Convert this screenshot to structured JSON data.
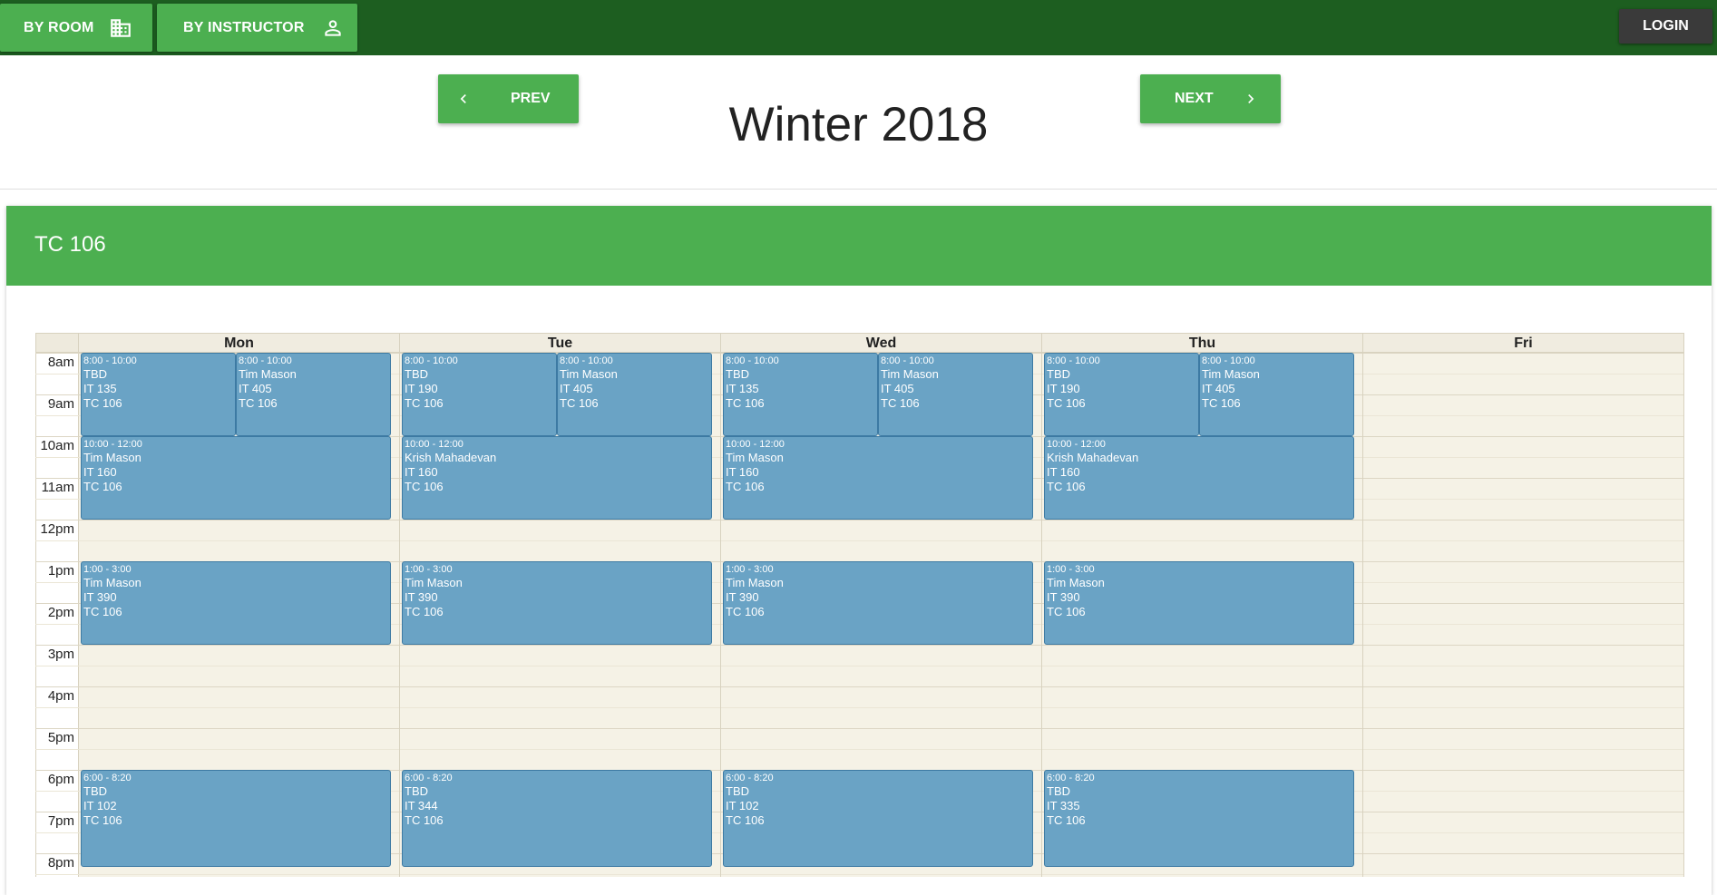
{
  "topbar": {
    "by_room_label": "BY ROOM",
    "by_room_icon": "building-icon",
    "by_instructor_label": "BY INSTRUCTOR",
    "by_instructor_icon": "person-icon",
    "login_label": "LOGIN"
  },
  "term": {
    "prev_label": "PREV",
    "next_label": "NEXT",
    "title": "Winter 2018"
  },
  "room": {
    "title": "TC 106"
  },
  "calendar": {
    "days": [
      "Mon",
      "Tue",
      "Wed",
      "Thu",
      "Fri"
    ],
    "hours": [
      "8am",
      "9am",
      "10am",
      "11am",
      "12pm",
      "1pm",
      "2pm",
      "3pm",
      "4pm",
      "5pm",
      "6pm",
      "7pm",
      "8pm"
    ],
    "events": [
      {
        "day": 0,
        "start": 8,
        "end": 10,
        "slot": 0,
        "slots": 2,
        "time": "8:00 - 10:00",
        "instructor": "TBD",
        "course": "IT 135",
        "room": "TC 106"
      },
      {
        "day": 0,
        "start": 8,
        "end": 10,
        "slot": 1,
        "slots": 2,
        "time": "8:00 - 10:00",
        "instructor": "Tim Mason",
        "course": "IT 405",
        "room": "TC 106"
      },
      {
        "day": 0,
        "start": 10,
        "end": 12,
        "slot": 0,
        "slots": 1,
        "time": "10:00 - 12:00",
        "instructor": "Tim Mason",
        "course": "IT 160",
        "room": "TC 106"
      },
      {
        "day": 0,
        "start": 13,
        "end": 15,
        "slot": 0,
        "slots": 1,
        "time": "1:00 - 3:00",
        "instructor": "Tim Mason",
        "course": "IT 390",
        "room": "TC 106"
      },
      {
        "day": 0,
        "start": 18,
        "end": 20.333,
        "slot": 0,
        "slots": 1,
        "time": "6:00 - 8:20",
        "instructor": "TBD",
        "course": "IT 102",
        "room": "TC 106"
      },
      {
        "day": 1,
        "start": 8,
        "end": 10,
        "slot": 0,
        "slots": 2,
        "time": "8:00 - 10:00",
        "instructor": "TBD",
        "course": "IT 190",
        "room": "TC 106"
      },
      {
        "day": 1,
        "start": 8,
        "end": 10,
        "slot": 1,
        "slots": 2,
        "time": "8:00 - 10:00",
        "instructor": "Tim Mason",
        "course": "IT 405",
        "room": "TC 106"
      },
      {
        "day": 1,
        "start": 10,
        "end": 12,
        "slot": 0,
        "slots": 1,
        "time": "10:00 - 12:00",
        "instructor": "Krish Mahadevan",
        "course": "IT 160",
        "room": "TC 106"
      },
      {
        "day": 1,
        "start": 13,
        "end": 15,
        "slot": 0,
        "slots": 1,
        "time": "1:00 - 3:00",
        "instructor": "Tim Mason",
        "course": "IT 390",
        "room": "TC 106"
      },
      {
        "day": 1,
        "start": 18,
        "end": 20.333,
        "slot": 0,
        "slots": 1,
        "time": "6:00 - 8:20",
        "instructor": "TBD",
        "course": "IT 344",
        "room": "TC 106"
      },
      {
        "day": 2,
        "start": 8,
        "end": 10,
        "slot": 0,
        "slots": 2,
        "time": "8:00 - 10:00",
        "instructor": "TBD",
        "course": "IT 135",
        "room": "TC 106"
      },
      {
        "day": 2,
        "start": 8,
        "end": 10,
        "slot": 1,
        "slots": 2,
        "time": "8:00 - 10:00",
        "instructor": "Tim Mason",
        "course": "IT 405",
        "room": "TC 106"
      },
      {
        "day": 2,
        "start": 10,
        "end": 12,
        "slot": 0,
        "slots": 1,
        "time": "10:00 - 12:00",
        "instructor": "Tim Mason",
        "course": "IT 160",
        "room": "TC 106"
      },
      {
        "day": 2,
        "start": 13,
        "end": 15,
        "slot": 0,
        "slots": 1,
        "time": "1:00 - 3:00",
        "instructor": "Tim Mason",
        "course": "IT 390",
        "room": "TC 106"
      },
      {
        "day": 2,
        "start": 18,
        "end": 20.333,
        "slot": 0,
        "slots": 1,
        "time": "6:00 - 8:20",
        "instructor": "TBD",
        "course": "IT 102",
        "room": "TC 106"
      },
      {
        "day": 3,
        "start": 8,
        "end": 10,
        "slot": 0,
        "slots": 2,
        "time": "8:00 - 10:00",
        "instructor": "TBD",
        "course": "IT 190",
        "room": "TC 106"
      },
      {
        "day": 3,
        "start": 8,
        "end": 10,
        "slot": 1,
        "slots": 2,
        "time": "8:00 - 10:00",
        "instructor": "Tim Mason",
        "course": "IT 405",
        "room": "TC 106"
      },
      {
        "day": 3,
        "start": 10,
        "end": 12,
        "slot": 0,
        "slots": 1,
        "time": "10:00 - 12:00",
        "instructor": "Krish Mahadevan",
        "course": "IT 160",
        "room": "TC 106"
      },
      {
        "day": 3,
        "start": 13,
        "end": 15,
        "slot": 0,
        "slots": 1,
        "time": "1:00 - 3:00",
        "instructor": "Tim Mason",
        "course": "IT 390",
        "room": "TC 106"
      },
      {
        "day": 3,
        "start": 18,
        "end": 20.333,
        "slot": 0,
        "slots": 1,
        "time": "6:00 - 8:20",
        "instructor": "TBD",
        "course": "IT 335",
        "room": "TC 106"
      }
    ]
  }
}
